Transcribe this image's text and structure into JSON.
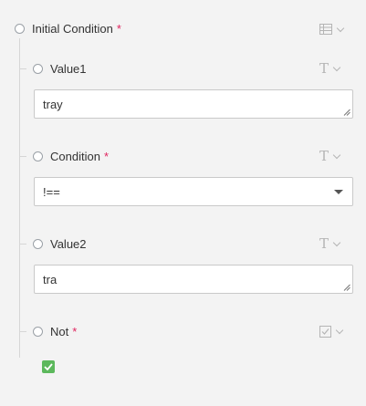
{
  "condition_group": {
    "title": "Initial Condition",
    "required_mark": "*",
    "type_icon": "table-icon"
  },
  "fields": {
    "value1": {
      "label": "Value1",
      "type_icon": "text-type-icon",
      "value": "tray"
    },
    "condition": {
      "label": "Condition",
      "required_mark": "*",
      "type_icon": "text-type-icon",
      "selected": "!=="
    },
    "value2": {
      "label": "Value2",
      "type_icon": "text-type-icon",
      "value": "tra"
    },
    "not": {
      "label": "Not",
      "required_mark": "*",
      "type_icon": "checkbox-type-icon",
      "checked": true
    }
  },
  "colors": {
    "background": "#f3f3f3",
    "required": "#e0245e",
    "checkbox": "#5cb85c"
  }
}
